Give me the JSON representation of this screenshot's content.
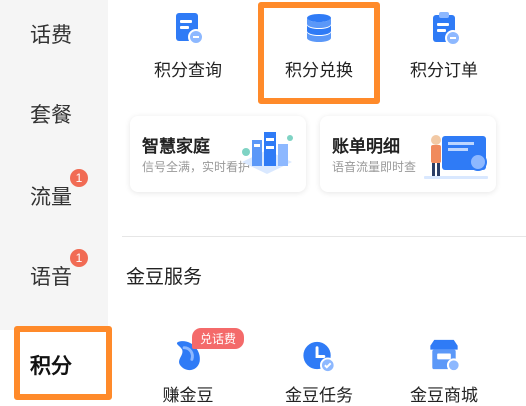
{
  "sidebar": {
    "items": [
      {
        "label": "话费"
      },
      {
        "label": "套餐"
      },
      {
        "label": "流量",
        "badge": "1"
      },
      {
        "label": "语音",
        "badge": "1"
      },
      {
        "label": "积分"
      }
    ]
  },
  "points": {
    "items": [
      {
        "label": "积分查询",
        "icon": "document-query-icon"
      },
      {
        "label": "积分兑换",
        "icon": "database-coins-icon"
      },
      {
        "label": "积分订单",
        "icon": "clipboard-order-icon"
      }
    ]
  },
  "cards": [
    {
      "title": "智慧家庭",
      "subtitle": "信号全满，实时看护"
    },
    {
      "title": "账单明细",
      "subtitle": "语音流量即时查"
    }
  ],
  "beans": {
    "title": "金豆服务",
    "tag": "兑话费",
    "items": [
      {
        "label": "赚金豆",
        "icon": "bean-icon"
      },
      {
        "label": "金豆任务",
        "icon": "task-clock-icon"
      },
      {
        "label": "金豆商城",
        "icon": "shop-icon"
      }
    ]
  },
  "colors": {
    "accent_blue": "#2f7bf6",
    "highlight_orange": "#ff8a2a",
    "badge_red": "#f16b54",
    "tag_red": "#f46a6a"
  }
}
